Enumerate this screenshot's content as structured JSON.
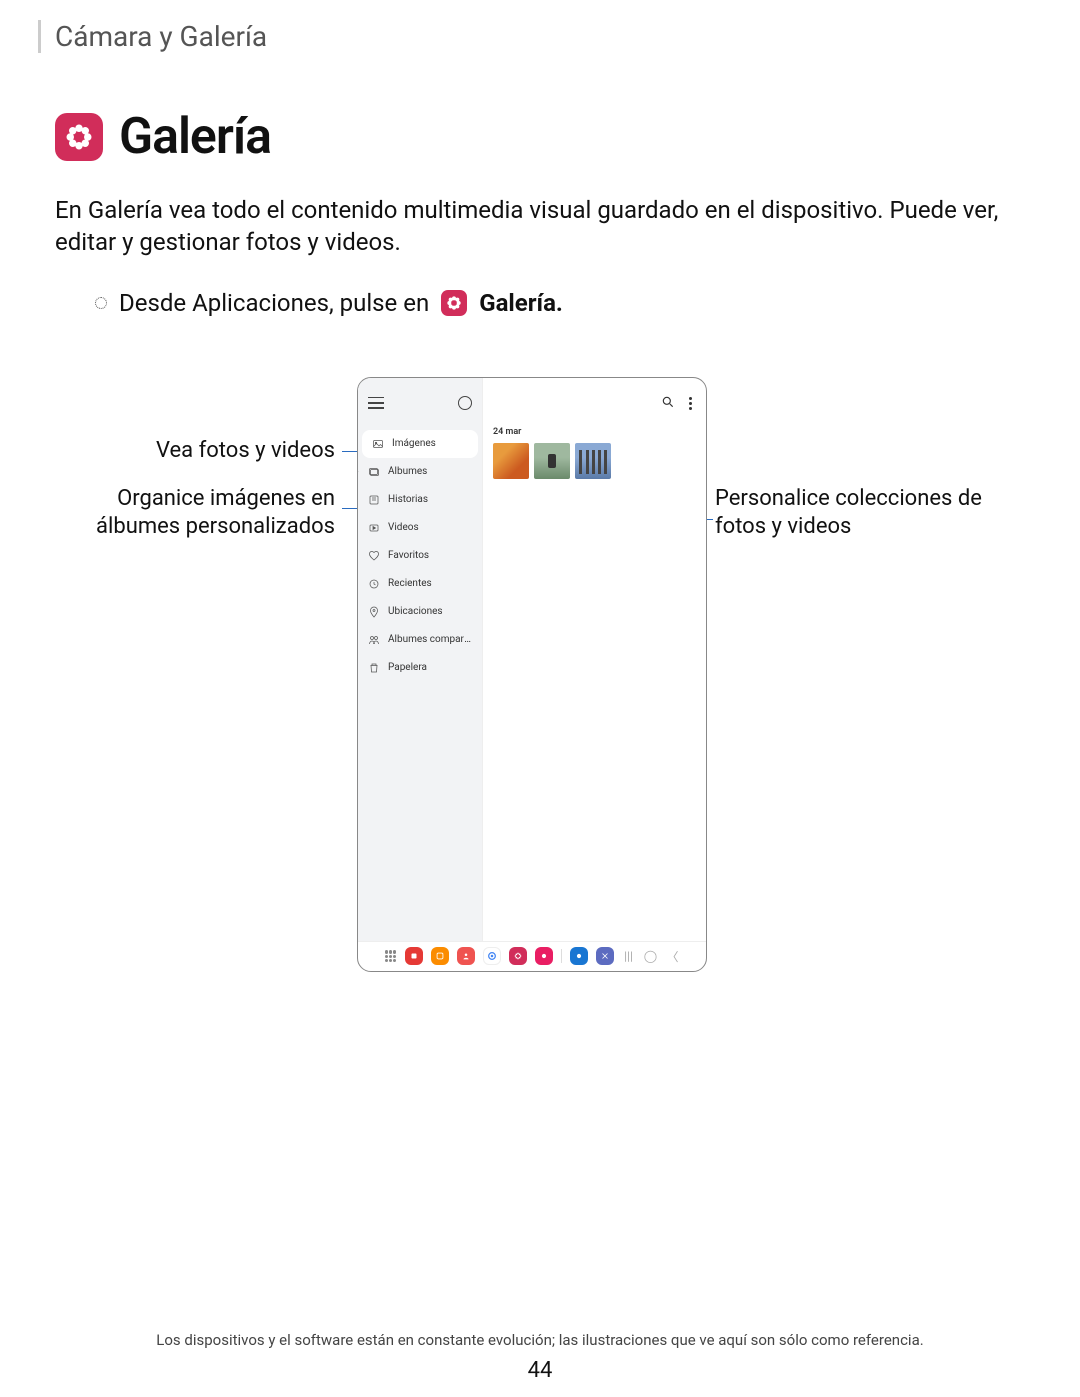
{
  "breadcrumb": "Cámara y Galería",
  "title": "Galería",
  "intro": "En Galería vea todo el contenido multimedia visual guardado en el dispositivo. Puede ver, editar y gestionar fotos y videos.",
  "instruction_prefix": "Desde Aplicaciones, pulse en",
  "instruction_app": "Galería.",
  "callouts": {
    "left1": "Vea fotos y videos",
    "left2": "Organice imágenes en álbumes personalizados",
    "right1": "Personalice colecciones de fotos y videos"
  },
  "device": {
    "date_header": "24 mar",
    "sidebar": {
      "items": [
        {
          "label": "Imágenes"
        },
        {
          "label": "Álbumes"
        },
        {
          "label": "Historias"
        },
        {
          "label": "Videos"
        },
        {
          "label": "Favoritos"
        },
        {
          "label": "Recientes"
        },
        {
          "label": "Ubicaciones"
        },
        {
          "label": "Álbumes compart…"
        },
        {
          "label": "Papelera"
        }
      ]
    }
  },
  "footnote": "Los dispositivos y el software están en constante evolución; las ilustraciones que ve aquí son sólo como referencia.",
  "page_number": "44"
}
